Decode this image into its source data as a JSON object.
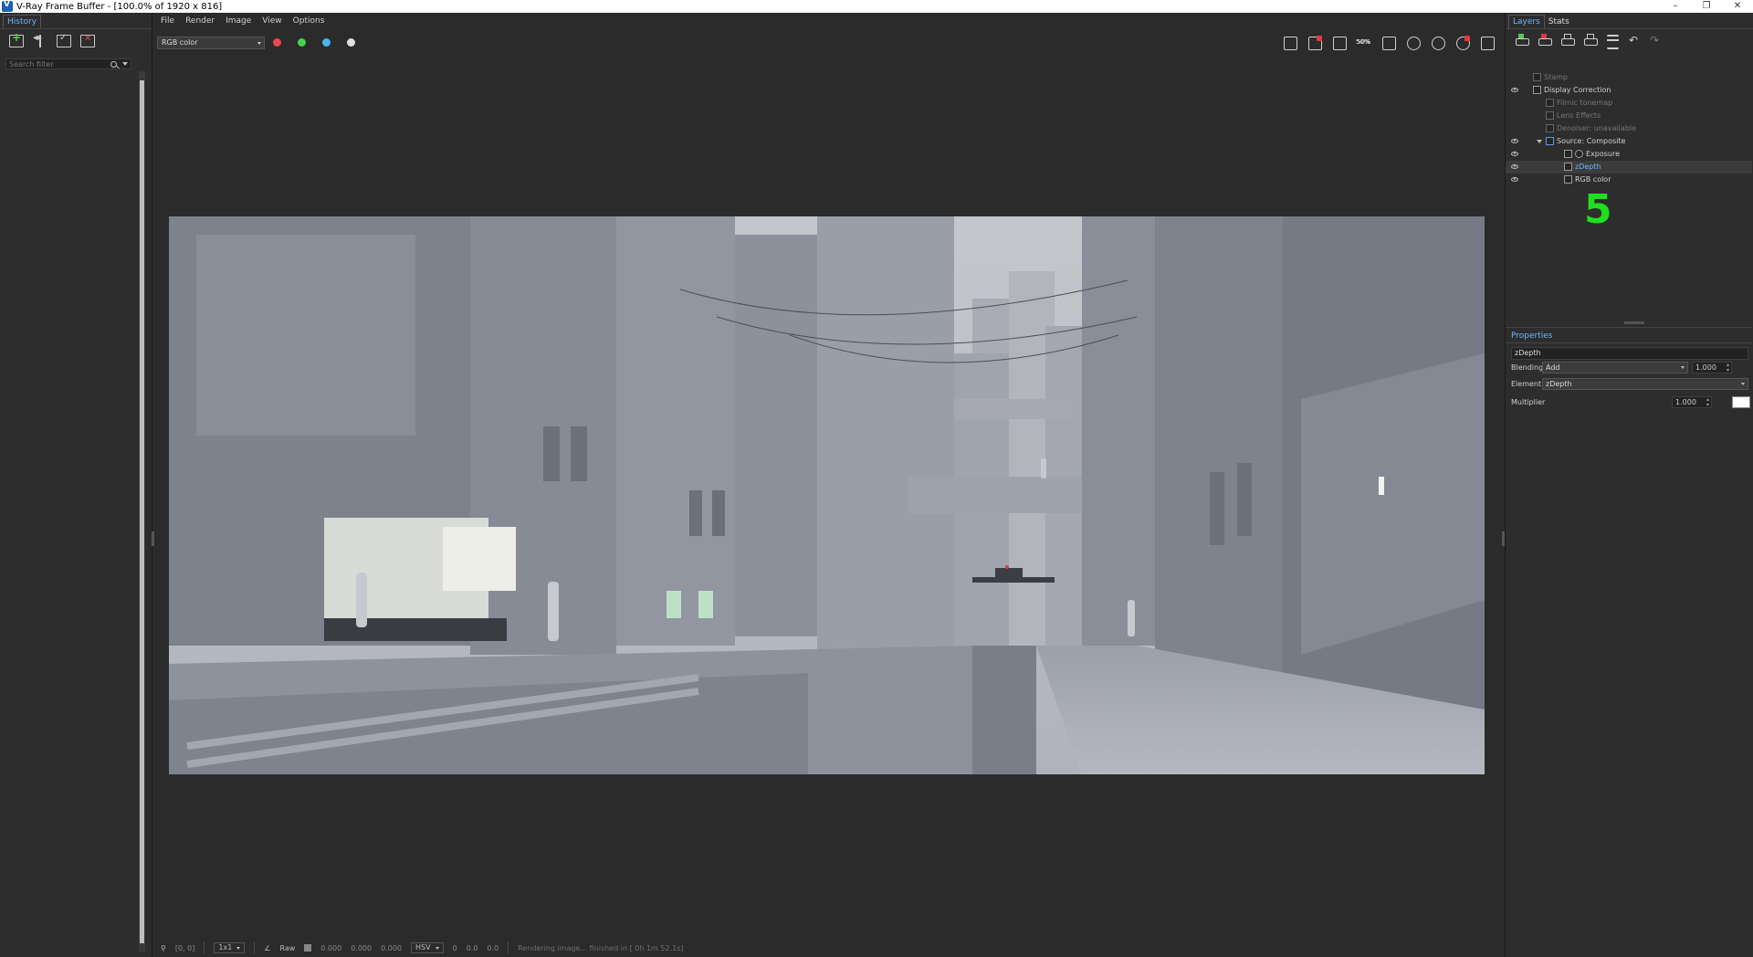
{
  "window": {
    "title": "V-Ray Frame Buffer - [100.0% of 1920 x 816]",
    "min": "–",
    "restore": "❐",
    "close": "✕"
  },
  "left_panel": {
    "tab": "History",
    "search_placeholder": "Search filter"
  },
  "menu": [
    "File",
    "Render",
    "Image",
    "View",
    "Options"
  ],
  "toolbar": {
    "channel": "RGB color",
    "dot_colors": [
      "#e84a4a",
      "#4ad04f",
      "#4ab6ea",
      "#e0e0e0"
    ],
    "zoom_label": "50%"
  },
  "right_panel": {
    "tabs": [
      "Layers",
      "Stats"
    ],
    "layers": [
      {
        "label": "Stamp",
        "visible": false,
        "dim": true
      },
      {
        "label": "Display Correction",
        "visible": true,
        "dim": false
      },
      {
        "label": "Filmic tonemap",
        "visible": false,
        "dim": true
      },
      {
        "label": "Lens Effects",
        "visible": false,
        "dim": true
      },
      {
        "label": "Denoiser: unavailable",
        "visible": false,
        "dim": true
      },
      {
        "label": "Source: Composite",
        "visible": true,
        "dim": false
      },
      {
        "label": "Exposure",
        "visible": true,
        "dim": false
      },
      {
        "label": "zDepth",
        "visible": true,
        "dim": false,
        "selected": true
      },
      {
        "label": "RGB color",
        "visible": true,
        "dim": false
      }
    ],
    "counter": "5",
    "properties": {
      "title": "Properties",
      "name": "zDepth",
      "blending_label": "Blending",
      "blending_value": "Add",
      "blending_amount": "1.000",
      "element_label": "Element",
      "element_value": "zDepth",
      "multiplier_label": "Multiplier",
      "multiplier_value": "1.000",
      "multiplier_color": "#ffffff"
    }
  },
  "status": {
    "coords": "[0, 0]",
    "ratio": "1x1",
    "raw_label": "Raw",
    "values": [
      "0.000",
      "0.000",
      "0.000"
    ],
    "mode": "HSV",
    "hsv": [
      "0",
      "0.0",
      "0.0"
    ],
    "message": "Rendering image... finished in [ 0h  1m 52.1s]"
  }
}
